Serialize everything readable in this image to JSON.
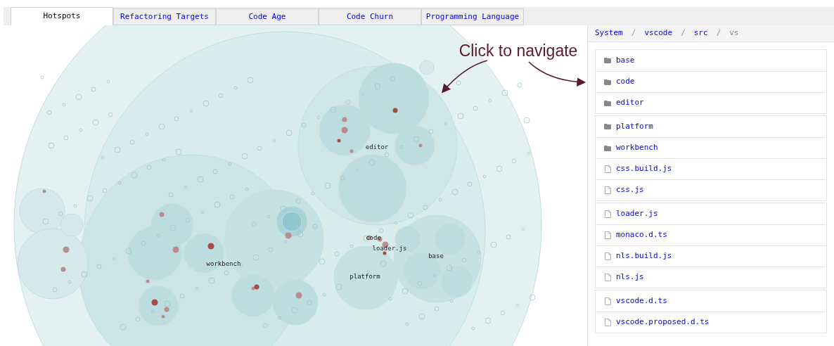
{
  "tabs": [
    {
      "label": "Hotspots",
      "selected": true
    },
    {
      "label": "Refactoring Targets",
      "selected": false
    },
    {
      "label": "Code Age",
      "selected": false
    },
    {
      "label": "Code Churn",
      "selected": false
    },
    {
      "label": "Programming Language",
      "selected": false
    }
  ],
  "map": {
    "labels": [
      "editor",
      "workbench",
      "code",
      "loader.js",
      "base",
      "platform"
    ],
    "annotation": "Click to navigate"
  },
  "breadcrumb": [
    {
      "label": "System",
      "link": true
    },
    {
      "separator": "/",
      "label": "vscode",
      "link": true
    },
    {
      "separator": "/",
      "label": "src",
      "link": true
    },
    {
      "separator": "/",
      "label": "vs",
      "link": false
    }
  ],
  "file_groups": [
    [
      {
        "name": "base",
        "kind": "folder"
      },
      {
        "name": "code",
        "kind": "folder"
      },
      {
        "name": "editor",
        "kind": "folder"
      }
    ],
    [
      {
        "name": "platform",
        "kind": "folder"
      },
      {
        "name": "workbench",
        "kind": "folder"
      },
      {
        "name": "css.build.js",
        "kind": "file"
      },
      {
        "name": "css.js",
        "kind": "file"
      }
    ],
    [
      {
        "name": "loader.js",
        "kind": "file"
      },
      {
        "name": "monaco.d.ts",
        "kind": "file"
      },
      {
        "name": "nls.build.js",
        "kind": "file"
      },
      {
        "name": "nls.js",
        "kind": "file"
      }
    ],
    [
      {
        "name": "vscode.d.ts",
        "kind": "file"
      },
      {
        "name": "vscode.proposed.d.ts",
        "kind": "file"
      }
    ]
  ]
}
